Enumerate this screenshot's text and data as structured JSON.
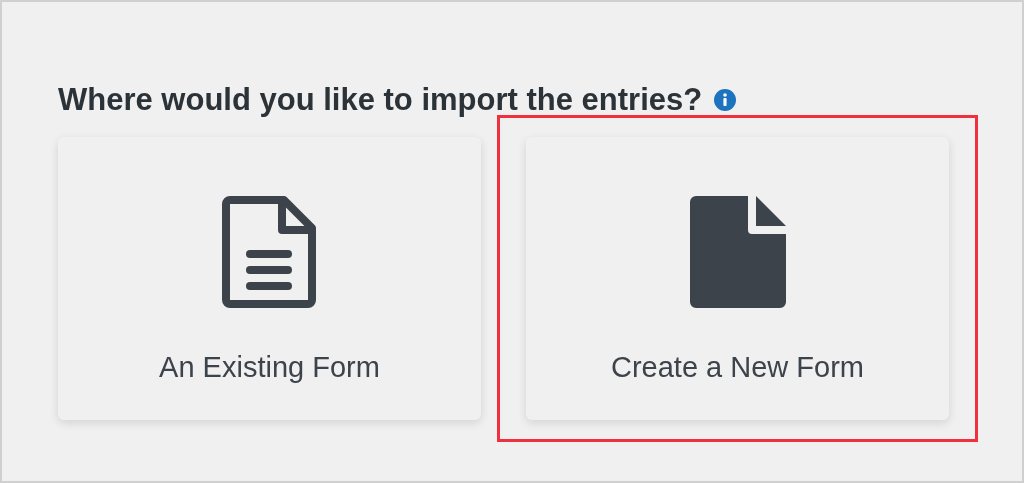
{
  "heading": {
    "text": "Where would you like to import the entries?",
    "info_icon": true
  },
  "options": [
    {
      "kind": "outline",
      "label": "An Existing Form",
      "highlighted": false
    },
    {
      "kind": "filled",
      "label": "Create a New Form",
      "highlighted": true
    }
  ]
}
